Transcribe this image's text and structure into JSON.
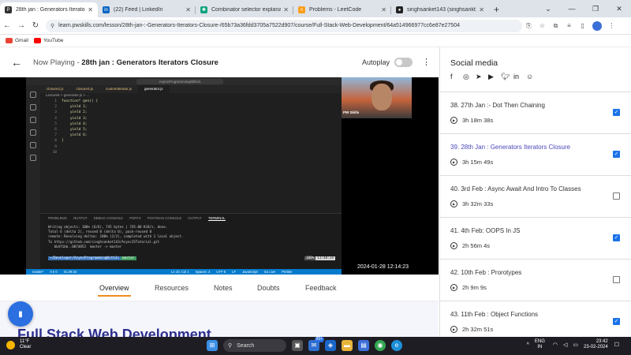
{
  "browser": {
    "tabs": [
      {
        "title": "28th jan : Generators Iterators",
        "color": "#333333",
        "icon": "pw-icon",
        "active": true
      },
      {
        "title": "(22) Feed | LinkedIn",
        "color": "#0a66c2",
        "icon": "linkedin-icon",
        "active": false
      },
      {
        "title": "Combinator selector explanatio",
        "color": "#10a37f",
        "icon": "chatgpt-icon",
        "active": false
      },
      {
        "title": "Problems - LeetCode",
        "color": "#f89f1b",
        "icon": "leetcode-icon",
        "active": false
      },
      {
        "title": "singhsanket143 (singhsankt14",
        "color": "#222222",
        "icon": "github-icon",
        "active": false
      }
    ],
    "url": "learn.pwskills.com/lesson/28th-jan-:-Generators-Iterators-Closure-/65b73a36fdd3705a7522d907/course/Full-Stack-Web-Development/64a514966977cc6e87e27504",
    "bookmarks": [
      {
        "label": "Gmail",
        "color": "#ea4335"
      },
      {
        "label": "YouTube",
        "color": "#ff0000"
      }
    ]
  },
  "player": {
    "now_playing_prefix": "Now Playing - ",
    "now_playing_title": "28th jan : Generators Iterators Closure",
    "autoplay_label": "Autoplay",
    "autoplay_on": false,
    "presenter_label": "PW Skills",
    "timestamp": "2024-01-28  12:14:23",
    "vscode": {
      "search": "AsyncProgrammingWithJs",
      "tabs": [
        "closure2.js",
        "closure3.js",
        "customIterator.js",
        "generator.js"
      ],
      "active_tab": "generator.js",
      "breadcrumb": "Lecture6 > generator.js > ...",
      "code_lines": [
        "function* gen() {",
        "    yield 1;",
        "    yield 2;",
        "    yield 3;",
        "    yield 4;",
        "    yield 5;",
        "    yield 6;",
        "}",
        "",
        ""
      ],
      "panel_tabs": [
        "PROBLEMS",
        "OUTPUT",
        "DEBUG CONSOLE",
        "PORTS",
        "POSTMAN CONSOLE",
        "OUTPUT",
        "TERMINAL"
      ],
      "terminal_lines": [
        "Writing objects: 100% (6/6), 745 bytes | 745.00 KiB/s, done.",
        "Total 6 (delta 2), reused 0 (delta 0), pack-reused 0",
        "remote: Resolving deltas: 100% (2/2), completed with 1 local object.",
        "To https://github.com/singhsanket143/AsyncJSTutorial.git",
        "   bb4f1bb..007d053  master -> master"
      ],
      "prompt_path": "~/Developer/AsyncProgrammingWithJs",
      "prompt_branch": "master",
      "term_right_1": "100%",
      "term_right_2": "11:48:34",
      "status_items": [
        "master*",
        "0 0 0",
        "01:29:33",
        "Ln 10, Col 1",
        "Spaces: 4",
        "UTF-8",
        "LF",
        "JavaScript",
        "Go Live",
        "Prettier"
      ]
    }
  },
  "content_tabs": [
    "Overview",
    "Resources",
    "Notes",
    "Doubts",
    "Feedback"
  ],
  "active_content_tab": "Overview",
  "course_title": "Full Stack Web Development",
  "sidebar": {
    "social_title": "Social media",
    "social_icons": [
      "facebook-icon",
      "instagram-icon",
      "telegram-icon",
      "youtube-icon",
      "twitter-icon",
      "linkedin-icon",
      "discord-icon"
    ],
    "lessons": [
      {
        "title": "38. 27th Jan :- Dot Then Chaining",
        "duration": "3h 18m 38s",
        "checked": true,
        "current": false
      },
      {
        "title": "39. 28th Jan : Generators Iterators Closure",
        "duration": "3h 15m 49s",
        "checked": true,
        "current": true
      },
      {
        "title": "40. 3rd Feb : Async Await And Intro To Classes",
        "duration": "3h 32m 33s",
        "checked": false,
        "current": false
      },
      {
        "title": "41. 4th Feb: OOPS In JS",
        "duration": "2h 56m 4s",
        "checked": true,
        "current": false
      },
      {
        "title": "42. 10th Feb : Prorotypes",
        "duration": "2h 9m 9s",
        "checked": false,
        "current": false
      },
      {
        "title": "43. 11th Feb : Object Functions",
        "duration": "2h 32m 51s",
        "checked": true,
        "current": false
      }
    ]
  },
  "taskbar": {
    "temp": "11°F",
    "weather": "Clear",
    "search_label": "Search",
    "badge": "99+",
    "lang1": "ENG",
    "lang2": "IN",
    "time": "23:42",
    "date": "23-02-2024"
  },
  "colors": {
    "accent": "#f08c1f",
    "current_lesson": "#4b48b8",
    "check": "#1a73e8"
  }
}
